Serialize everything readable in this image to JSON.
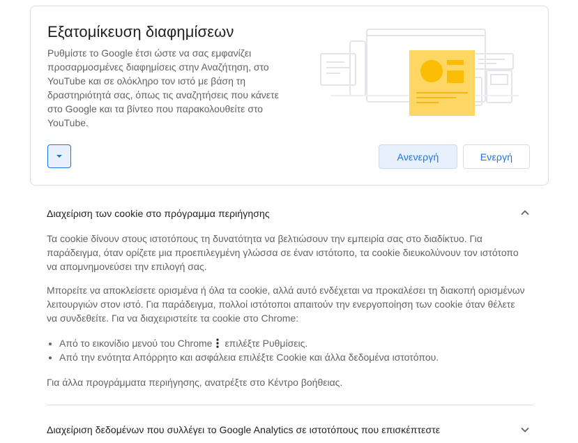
{
  "ad_card": {
    "title": "Εξατομίκευση διαφημίσεων",
    "description": "Ρυθμίστε το Google έτσι ώστε να σας εμφανίζει προσαρμοσμένες διαφημίσεις στην Αναζήτηση, στο YouTube και σε ολόκληρο τον ιστό με βάση τη δραστηριότητά σας, όπως τις αναζητήσεις που κάνετε στο Google και τα βίντεο που παρακολουθείτε στο YouTube.",
    "off_label": "Ανενεργή",
    "on_label": "Ενεργή",
    "illustration_accent": "#fdd663",
    "expand_icon": "caret-down-icon"
  },
  "cookies_section": {
    "heading": "Διαχείριση των cookie στο πρόγραμμα περιήγησης",
    "expanded": true,
    "para1": "Τα cookie δίνουν στους ιστοτόπους τη δυνατότητα να βελτιώσουν την εμπειρία σας στο διαδίκτυο. Για παράδειγμα, όταν ορίζετε μια προεπιλεγμένη γλώσσα σε έναν ιστότοπο, τα cookie διευκολύνουν τον ιστότοπο να απομνημονεύσει την επιλογή σας.",
    "para2": "Μπορείτε να αποκλείσετε ορισμένα ή όλα τα cookie, αλλά αυτό ενδέχεται να προκαλέσει τη διακοπή ορισμένων λειτουργιών στον ιστό. Για παράδειγμα, πολλοί ιστότοποι απαιτούν την ενεργοποίηση των cookie όταν θέλετε να συνδεθείτε. Για να διαχειριστείτε τα cookie στο Chrome:",
    "bullet1_before": "Από το εικονίδιο μενού του Chrome",
    "bullet1_after": "επιλέξτε Ρυθμίσεις.",
    "bullet2": "Από την ενότητα Απόρρητο και ασφάλεια επιλέξτε Cookie και άλλα δεδομένα ιστοτόπου.",
    "para3": "Για άλλα προγράμματα περιήγησης, ανατρέξτε στο Κέντρο βοήθειας."
  },
  "analytics_section": {
    "heading": "Διαχείριση δεδομένων που συλλέγει το Google Analytics σε ιστοτόπους που επισκέπτεστε",
    "expanded": false
  }
}
